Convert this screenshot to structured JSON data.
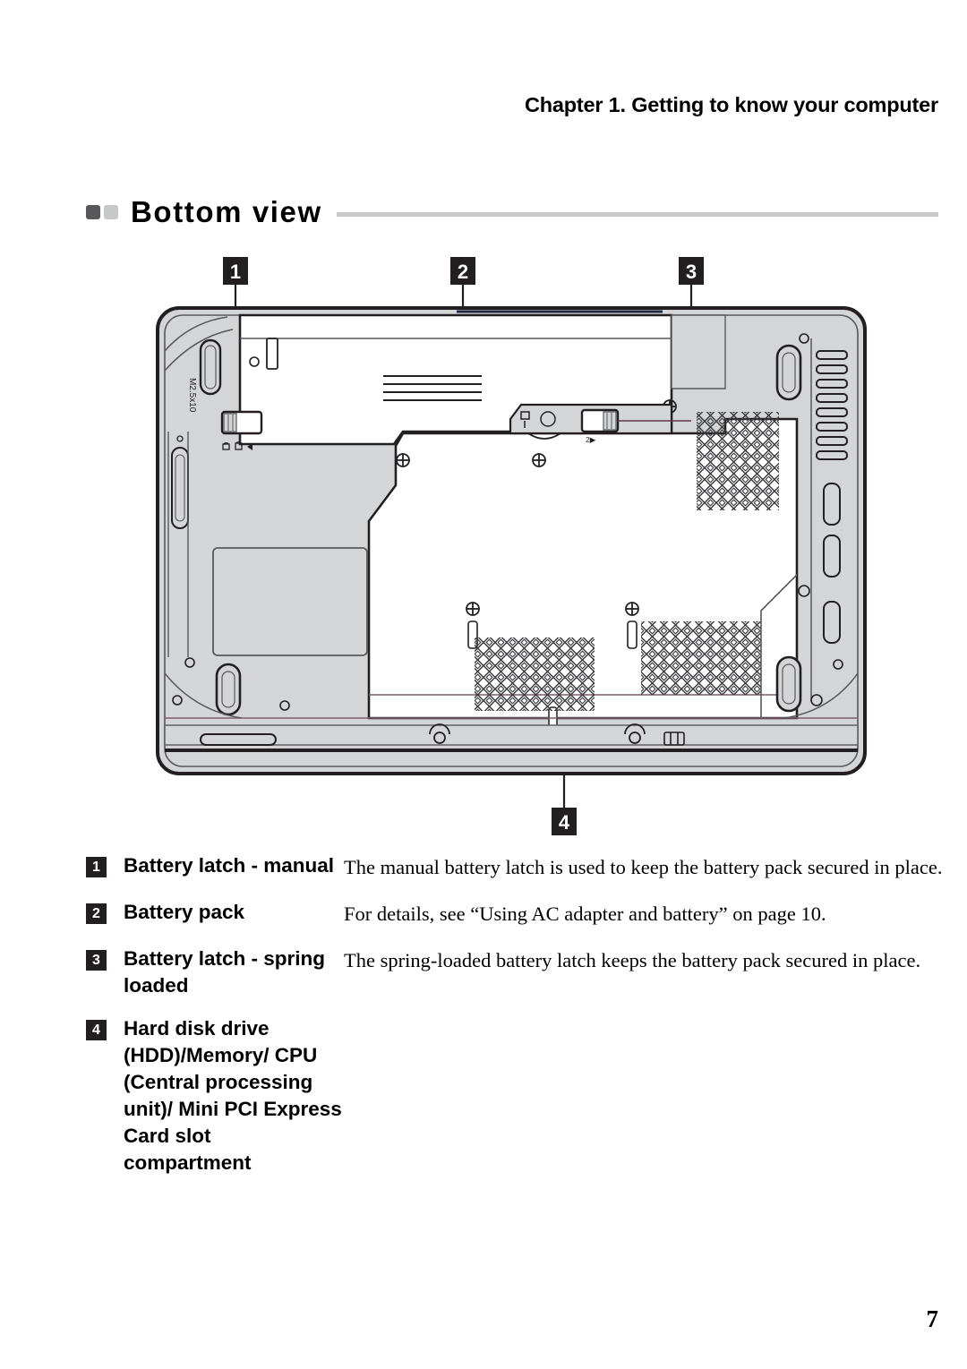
{
  "header": {
    "running_head": "Chapter 1. Getting to know your computer"
  },
  "section": {
    "title": "Bottom view",
    "bullet_dark_color": "#58585a",
    "bullet_light_color": "#c7c8ca",
    "rule_color": "#c7c8ca"
  },
  "figure": {
    "alt": "Bottom view of notebook computer chassis",
    "callouts": [
      {
        "number": "1",
        "target": "battery-latch-manual"
      },
      {
        "number": "2",
        "target": "battery-pack"
      },
      {
        "number": "3",
        "target": "battery-latch-spring-loaded"
      },
      {
        "number": "4",
        "target": "hdd-memory-cpu-compartment"
      }
    ],
    "annotations": {
      "screw_spec": "M2.5x10",
      "spring_latch_glyph": "2▶",
      "badge_bg": "#231f20",
      "badge_fg": "#ffffff",
      "body_fill": "#d4d5d7",
      "panel_fill": "#ffffff",
      "line_color": "#231f20"
    }
  },
  "legend": {
    "items": [
      {
        "number": "1",
        "term": "Battery latch - manual",
        "description": "The manual battery latch is used to keep the battery pack secured in place."
      },
      {
        "number": "2",
        "term": "Battery pack",
        "description": "For details, see “Using AC adapter and battery” on page 10."
      },
      {
        "number": "3",
        "term": "Battery latch - spring loaded",
        "description": "The spring-loaded battery latch keeps the battery pack secured in place."
      },
      {
        "number": "4",
        "term": "Hard disk drive (HDD)/Memory/ CPU (Central processing unit)/ Mini PCI Express Card slot compartment",
        "description": ""
      }
    ]
  },
  "footer": {
    "page_number": "7"
  }
}
